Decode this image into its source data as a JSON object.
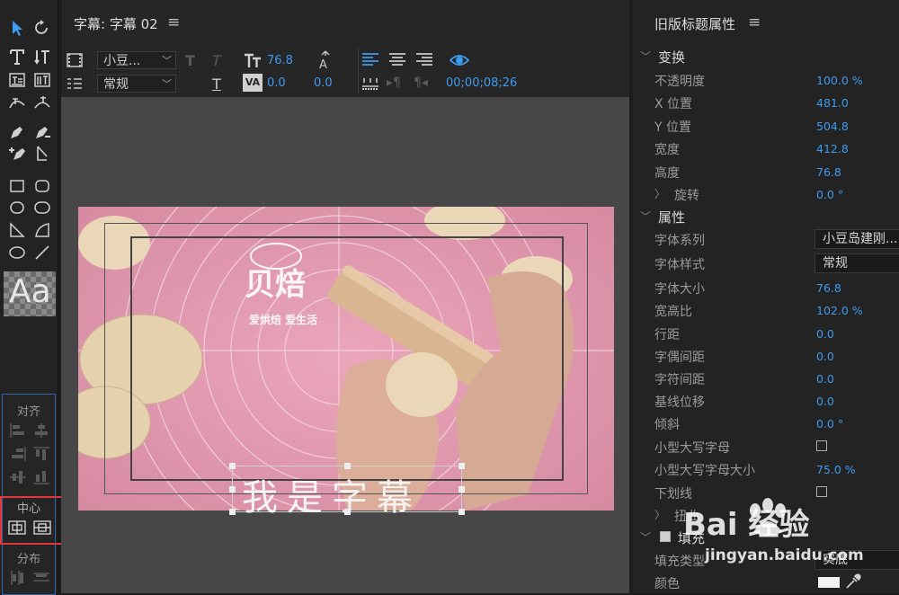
{
  "editor": {
    "title": "字幕: 字幕 02",
    "menu_glyph": "≡",
    "font_family": "小豆...",
    "font_style": "常规",
    "font_size": "76.8",
    "kerning": "0.0",
    "tracking": "0.0",
    "timecode": "00;00;08;26",
    "title_text": "我是字幕"
  },
  "tools": {
    "preview_glyph": "Aa",
    "align_label": "对齐",
    "center_label": "中心",
    "distribute_label": "分布"
  },
  "props": {
    "panel_title": "旧版标题属性",
    "menu_glyph": "≡",
    "transform_section": "变换",
    "opacity_label": "不透明度",
    "opacity_value": "100.0 %",
    "xpos_label": "X 位置",
    "xpos_value": "481.0",
    "ypos_label": "Y 位置",
    "ypos_value": "504.8",
    "width_label": "宽度",
    "width_value": "412.8",
    "height_label": "高度",
    "height_value": "76.8",
    "rotation_label": "旋转",
    "rotation_value": "0.0 °",
    "attributes_section": "属性",
    "font_family_label": "字体系列",
    "font_family_value": "小豆岛建刚...",
    "font_style_label": "字体样式",
    "font_style_value": "常规",
    "font_size_label": "字体大小",
    "font_size_value": "76.8",
    "aspect_label": "宽高比",
    "aspect_value": "102.0 %",
    "leading_label": "行距",
    "leading_value": "0.0",
    "kerning_label": "字偶间距",
    "kerning_value": "0.0",
    "tracking_label": "字符间距",
    "tracking_value": "0.0",
    "baseline_label": "基线位移",
    "baseline_value": "0.0",
    "slant_label": "倾斜",
    "slant_value": "0.0 °",
    "smallcaps_label": "小型大写字母",
    "smallcaps_size_label": "小型大写字母大小",
    "smallcaps_size_value": "75.0 %",
    "underline_label": "下划线",
    "distort_label": "扭曲",
    "fill_section": "填充",
    "fill_type_label": "填充类型",
    "fill_type_value": "实底",
    "color_label": "颜色"
  },
  "watermark": {
    "brand": "Bai  经验",
    "url": "jingyan.baidu.com"
  },
  "colors": {
    "accent": "#3e9bf0",
    "canvas_bg": "#474747",
    "video_pink": "#e8a3b8",
    "highlight": "#e0383a"
  }
}
